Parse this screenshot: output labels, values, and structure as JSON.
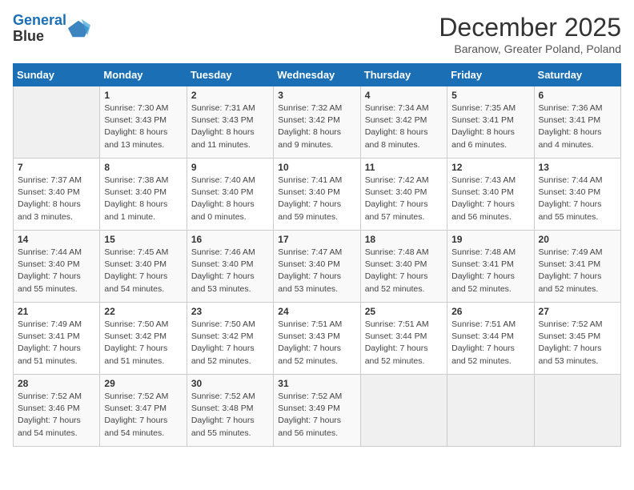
{
  "logo": {
    "line1": "General",
    "line2": "Blue"
  },
  "title": "December 2025",
  "location": "Baranow, Greater Poland, Poland",
  "days_of_week": [
    "Sunday",
    "Monday",
    "Tuesday",
    "Wednesday",
    "Thursday",
    "Friday",
    "Saturday"
  ],
  "weeks": [
    [
      {
        "day": "",
        "info": ""
      },
      {
        "day": "1",
        "info": "Sunrise: 7:30 AM\nSunset: 3:43 PM\nDaylight: 8 hours\nand 13 minutes."
      },
      {
        "day": "2",
        "info": "Sunrise: 7:31 AM\nSunset: 3:43 PM\nDaylight: 8 hours\nand 11 minutes."
      },
      {
        "day": "3",
        "info": "Sunrise: 7:32 AM\nSunset: 3:42 PM\nDaylight: 8 hours\nand 9 minutes."
      },
      {
        "day": "4",
        "info": "Sunrise: 7:34 AM\nSunset: 3:42 PM\nDaylight: 8 hours\nand 8 minutes."
      },
      {
        "day": "5",
        "info": "Sunrise: 7:35 AM\nSunset: 3:41 PM\nDaylight: 8 hours\nand 6 minutes."
      },
      {
        "day": "6",
        "info": "Sunrise: 7:36 AM\nSunset: 3:41 PM\nDaylight: 8 hours\nand 4 minutes."
      }
    ],
    [
      {
        "day": "7",
        "info": "Sunrise: 7:37 AM\nSunset: 3:40 PM\nDaylight: 8 hours\nand 3 minutes."
      },
      {
        "day": "8",
        "info": "Sunrise: 7:38 AM\nSunset: 3:40 PM\nDaylight: 8 hours\nand 1 minute."
      },
      {
        "day": "9",
        "info": "Sunrise: 7:40 AM\nSunset: 3:40 PM\nDaylight: 8 hours\nand 0 minutes."
      },
      {
        "day": "10",
        "info": "Sunrise: 7:41 AM\nSunset: 3:40 PM\nDaylight: 7 hours\nand 59 minutes."
      },
      {
        "day": "11",
        "info": "Sunrise: 7:42 AM\nSunset: 3:40 PM\nDaylight: 7 hours\nand 57 minutes."
      },
      {
        "day": "12",
        "info": "Sunrise: 7:43 AM\nSunset: 3:40 PM\nDaylight: 7 hours\nand 56 minutes."
      },
      {
        "day": "13",
        "info": "Sunrise: 7:44 AM\nSunset: 3:40 PM\nDaylight: 7 hours\nand 55 minutes."
      }
    ],
    [
      {
        "day": "14",
        "info": "Sunrise: 7:44 AM\nSunset: 3:40 PM\nDaylight: 7 hours\nand 55 minutes."
      },
      {
        "day": "15",
        "info": "Sunrise: 7:45 AM\nSunset: 3:40 PM\nDaylight: 7 hours\nand 54 minutes."
      },
      {
        "day": "16",
        "info": "Sunrise: 7:46 AM\nSunset: 3:40 PM\nDaylight: 7 hours\nand 53 minutes."
      },
      {
        "day": "17",
        "info": "Sunrise: 7:47 AM\nSunset: 3:40 PM\nDaylight: 7 hours\nand 53 minutes."
      },
      {
        "day": "18",
        "info": "Sunrise: 7:48 AM\nSunset: 3:40 PM\nDaylight: 7 hours\nand 52 minutes."
      },
      {
        "day": "19",
        "info": "Sunrise: 7:48 AM\nSunset: 3:41 PM\nDaylight: 7 hours\nand 52 minutes."
      },
      {
        "day": "20",
        "info": "Sunrise: 7:49 AM\nSunset: 3:41 PM\nDaylight: 7 hours\nand 52 minutes."
      }
    ],
    [
      {
        "day": "21",
        "info": "Sunrise: 7:49 AM\nSunset: 3:41 PM\nDaylight: 7 hours\nand 51 minutes."
      },
      {
        "day": "22",
        "info": "Sunrise: 7:50 AM\nSunset: 3:42 PM\nDaylight: 7 hours\nand 51 minutes."
      },
      {
        "day": "23",
        "info": "Sunrise: 7:50 AM\nSunset: 3:42 PM\nDaylight: 7 hours\nand 52 minutes."
      },
      {
        "day": "24",
        "info": "Sunrise: 7:51 AM\nSunset: 3:43 PM\nDaylight: 7 hours\nand 52 minutes."
      },
      {
        "day": "25",
        "info": "Sunrise: 7:51 AM\nSunset: 3:44 PM\nDaylight: 7 hours\nand 52 minutes."
      },
      {
        "day": "26",
        "info": "Sunrise: 7:51 AM\nSunset: 3:44 PM\nDaylight: 7 hours\nand 52 minutes."
      },
      {
        "day": "27",
        "info": "Sunrise: 7:52 AM\nSunset: 3:45 PM\nDaylight: 7 hours\nand 53 minutes."
      }
    ],
    [
      {
        "day": "28",
        "info": "Sunrise: 7:52 AM\nSunset: 3:46 PM\nDaylight: 7 hours\nand 54 minutes."
      },
      {
        "day": "29",
        "info": "Sunrise: 7:52 AM\nSunset: 3:47 PM\nDaylight: 7 hours\nand 54 minutes."
      },
      {
        "day": "30",
        "info": "Sunrise: 7:52 AM\nSunset: 3:48 PM\nDaylight: 7 hours\nand 55 minutes."
      },
      {
        "day": "31",
        "info": "Sunrise: 7:52 AM\nSunset: 3:49 PM\nDaylight: 7 hours\nand 56 minutes."
      },
      {
        "day": "",
        "info": ""
      },
      {
        "day": "",
        "info": ""
      },
      {
        "day": "",
        "info": ""
      }
    ]
  ]
}
